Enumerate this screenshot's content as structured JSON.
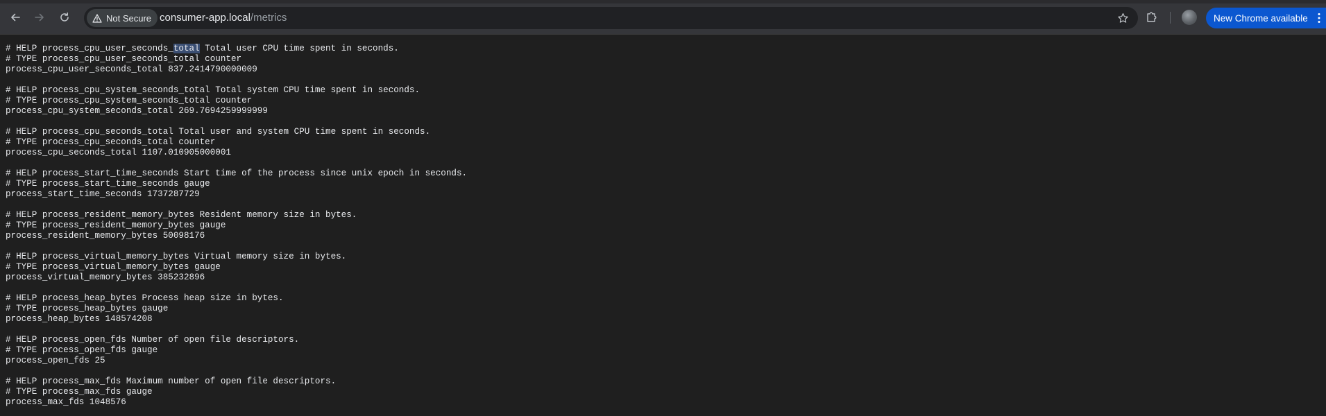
{
  "browser": {
    "security_label": "Not Secure",
    "url_host": "consumer-app.local",
    "url_path": "/metrics",
    "update_label": "New Chrome available"
  },
  "icons": {
    "back": "back-arrow-icon",
    "forward": "forward-arrow-icon",
    "reload": "reload-icon",
    "warning": "warning-triangle-icon",
    "bookmark": "star-icon",
    "extensions": "puzzle-icon",
    "profile": "avatar",
    "menu": "kebab-menu-icon"
  },
  "colors": {
    "toolbar": "#35363a",
    "page_bg": "#1f1f1f",
    "update_button": "#0b57d0",
    "selection": "#3b4f73"
  },
  "metrics": {
    "line1_pre": "# HELP process_cpu_user_seconds_",
    "line1_selected": "total",
    "line1_post": " Total user CPU time spent in seconds.",
    "body": "# TYPE process_cpu_user_seconds_total counter\nprocess_cpu_user_seconds_total 837.2414790000009\n\n# HELP process_cpu_system_seconds_total Total system CPU time spent in seconds.\n# TYPE process_cpu_system_seconds_total counter\nprocess_cpu_system_seconds_total 269.7694259999999\n\n# HELP process_cpu_seconds_total Total user and system CPU time spent in seconds.\n# TYPE process_cpu_seconds_total counter\nprocess_cpu_seconds_total 1107.010905000001\n\n# HELP process_start_time_seconds Start time of the process since unix epoch in seconds.\n# TYPE process_start_time_seconds gauge\nprocess_start_time_seconds 1737287729\n\n# HELP process_resident_memory_bytes Resident memory size in bytes.\n# TYPE process_resident_memory_bytes gauge\nprocess_resident_memory_bytes 50098176\n\n# HELP process_virtual_memory_bytes Virtual memory size in bytes.\n# TYPE process_virtual_memory_bytes gauge\nprocess_virtual_memory_bytes 385232896\n\n# HELP process_heap_bytes Process heap size in bytes.\n# TYPE process_heap_bytes gauge\nprocess_heap_bytes 148574208\n\n# HELP process_open_fds Number of open file descriptors.\n# TYPE process_open_fds gauge\nprocess_open_fds 25\n\n# HELP process_max_fds Maximum number of open file descriptors.\n# TYPE process_max_fds gauge\nprocess_max_fds 1048576"
  }
}
